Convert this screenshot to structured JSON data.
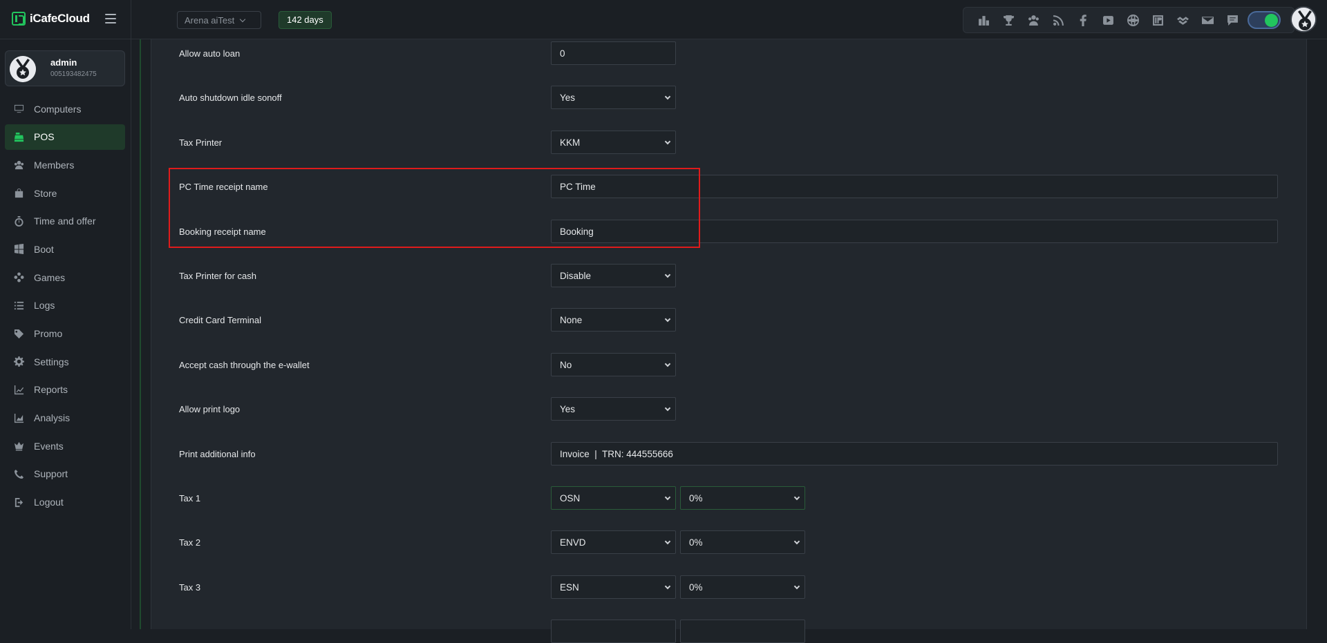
{
  "app": {
    "name": "iCafeCloud"
  },
  "header": {
    "cafe_name": "Arena aiTest",
    "days_badge": "142 days",
    "icons": [
      "rank-icon",
      "trophy-icon",
      "group-icon",
      "rss-icon",
      "facebook-icon",
      "youtube-icon",
      "globe-icon",
      "icafe-icon",
      "handshake-icon",
      "mail-icon",
      "chat-icon"
    ],
    "theme_toggle_on": true
  },
  "user": {
    "name": "admin",
    "id": "005193482475"
  },
  "sidebar": {
    "items": [
      {
        "label": "Computers",
        "icon": "monitor-icon",
        "active": false
      },
      {
        "label": "POS",
        "icon": "cash-register-icon",
        "active": true
      },
      {
        "label": "Members",
        "icon": "users-icon",
        "active": false
      },
      {
        "label": "Store",
        "icon": "bag-icon",
        "active": false
      },
      {
        "label": "Time and offer",
        "icon": "stopwatch-icon",
        "active": false
      },
      {
        "label": "Boot",
        "icon": "windows-icon",
        "active": false
      },
      {
        "label": "Games",
        "icon": "gamepad-icon",
        "active": false
      },
      {
        "label": "Logs",
        "icon": "list-icon",
        "active": false
      },
      {
        "label": "Promo",
        "icon": "tag-icon",
        "active": false
      },
      {
        "label": "Settings",
        "icon": "gear-icon",
        "active": false
      },
      {
        "label": "Reports",
        "icon": "line-chart-icon",
        "active": false
      },
      {
        "label": "Analysis",
        "icon": "area-chart-icon",
        "active": false
      },
      {
        "label": "Events",
        "icon": "crown-icon",
        "active": false
      },
      {
        "label": "Support",
        "icon": "phone-icon",
        "active": false
      },
      {
        "label": "Logout",
        "icon": "logout-icon",
        "active": false
      }
    ]
  },
  "settings": {
    "rows": [
      {
        "label": "Allow auto loan",
        "type": "input",
        "value": "0"
      },
      {
        "label": "Auto shutdown idle sonoff",
        "type": "select",
        "value": "Yes"
      },
      {
        "label": "Tax Printer",
        "type": "select",
        "value": "KKM"
      },
      {
        "label": "PC Time receipt name",
        "type": "input-wide",
        "value": "PC Time"
      },
      {
        "label": "Booking receipt name",
        "type": "input-wide",
        "value": "Booking"
      },
      {
        "label": "Tax Printer for cash",
        "type": "select",
        "value": "Disable"
      },
      {
        "label": "Credit Card Terminal",
        "type": "select",
        "value": "None"
      },
      {
        "label": "Accept cash through the e-wallet",
        "type": "select",
        "value": "No"
      },
      {
        "label": "Allow print logo",
        "type": "select",
        "value": "Yes"
      },
      {
        "label": "Print additional info",
        "type": "input-wide",
        "value": "Invoice  |  TRN: 444555666"
      },
      {
        "label": "Tax 1",
        "type": "select-pair",
        "value": "OSN",
        "value2": "0%"
      },
      {
        "label": "Tax 2",
        "type": "select-pair",
        "value": "ENVD",
        "value2": "0%"
      },
      {
        "label": "Tax 3",
        "type": "select-pair",
        "value": "ESN",
        "value2": "0%"
      }
    ],
    "highlight_color": "#e01b1b"
  }
}
